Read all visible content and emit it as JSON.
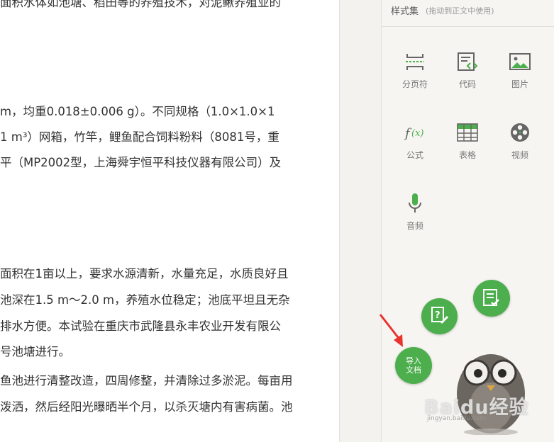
{
  "document": {
    "lines": [
      "面积水体如池塘、稻田等的养殖技术，对泥鳅养殖业的",
      "m，均重0.018±0.006 g）。不同规格（1.0×1.0×1",
      "1 m³）网箱，竹竿，鲤鱼配合饲料粉料（8081号，重",
      "平（MP2002型，上海舜宇恒平科技仪器有限公司）及",
      "面积在1亩以上，要求水源清新，水量充足，水质良好且",
      "池深在1.5 m～2.0 m，养殖水位稳定；池底平坦且无杂",
      "排水方便。本试验在重庆市武隆县永丰农业开发有限公",
      "号池塘进行。",
      "鱼池进行清整改造，四周修整，并清除过多淤泥。每亩用",
      "泼洒，然后经阳光曝晒半个月，以杀灭塘内有害病菌。池"
    ]
  },
  "panel": {
    "title": "样式集",
    "subtitle": "(拖动到正文中使用)",
    "tools": [
      {
        "label": "分页符",
        "icon": "page-break-icon"
      },
      {
        "label": "代码",
        "icon": "code-icon"
      },
      {
        "label": "图片",
        "icon": "image-icon"
      },
      {
        "label": "公式",
        "icon": "formula-icon"
      },
      {
        "label": "表格",
        "icon": "table-icon"
      },
      {
        "label": "视频",
        "icon": "video-icon"
      },
      {
        "label": "音频",
        "icon": "microphone-icon"
      }
    ]
  },
  "fab": {
    "import_label_1": "导入",
    "import_label_2": "文档"
  },
  "watermark": {
    "brand": "Baidu经验",
    "url": "jingyan.baidu.com"
  },
  "colors": {
    "accent_green": "#4cae4c",
    "arrow_red": "#e8332f",
    "icon_gray": "#666666"
  }
}
